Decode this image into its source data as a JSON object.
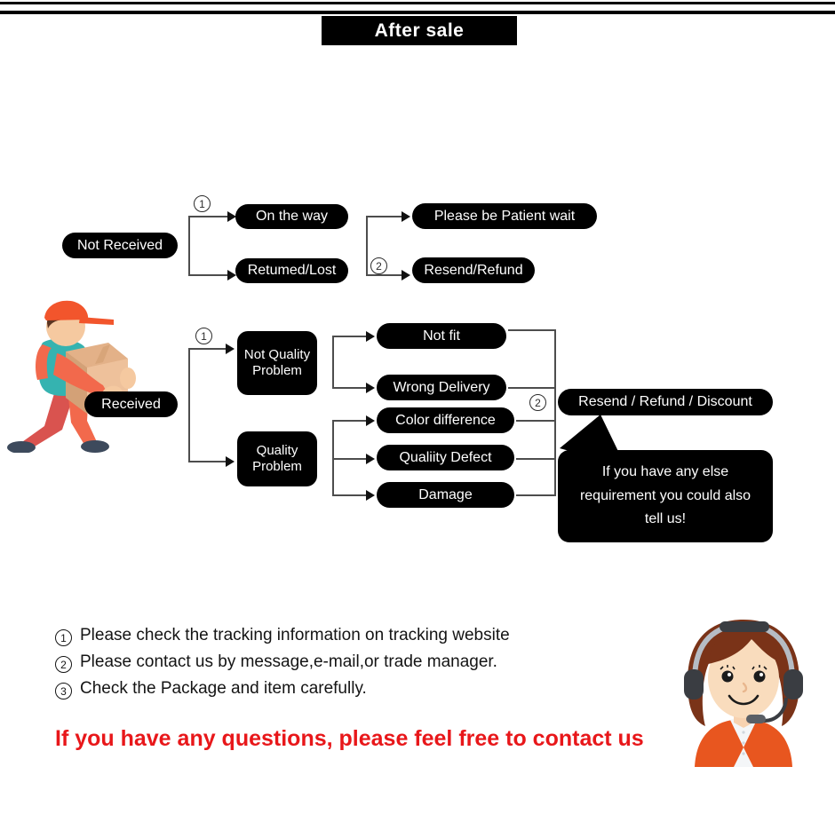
{
  "header": {
    "title": "After sale"
  },
  "flow_not_received": {
    "source": {
      "label": "Not Received"
    },
    "marker_1": "1",
    "marker_2": "2",
    "stage1": [
      {
        "label": "On the way"
      },
      {
        "label": "Retumed/Lost"
      }
    ],
    "stage2": [
      {
        "label": "Please be Patient wait"
      },
      {
        "label": "Resend/Refund"
      }
    ]
  },
  "flow_received": {
    "source": {
      "label": "Received"
    },
    "marker_1": "1",
    "marker_2": "2",
    "categories": [
      {
        "label": "Not Quality Problem"
      },
      {
        "label": "Quality Problem"
      }
    ],
    "issues": [
      {
        "label": "Not fit"
      },
      {
        "label": "Wrong Delivery"
      },
      {
        "label": "Color difference"
      },
      {
        "label": "Qualiity Defect"
      },
      {
        "label": "Damage"
      }
    ],
    "resolution": {
      "label": "Resend / Refund / Discount"
    },
    "bubble": {
      "text": "If you have any else requirement you could also tell us!"
    }
  },
  "notes": [
    {
      "num": "1",
      "text": "Please check the tracking information on tracking website"
    },
    {
      "num": "2",
      "text": "Please contact us by message,e-mail,or trade manager."
    },
    {
      "num": "3",
      "text": "Check the Package and item carefully."
    }
  ],
  "footer": {
    "red_text": "If you have any questions, please feel free to contact us"
  },
  "illustrations": {
    "courier": "delivery-man-carrying-box-illustration",
    "agent": "customer-service-agent-headset-illustration"
  },
  "colors": {
    "node_bg": "#000000",
    "node_text": "#ffffff",
    "connector": "#4d4d4d",
    "accent_red": "#e8171a",
    "courier_shirt": "#3bb9b5",
    "courier_cap": "#f2552c",
    "courier_pants": "#f2552c",
    "box_tan": "#e3b188",
    "agent_hair": "#8c3a22",
    "agent_sweater": "#e8561f"
  }
}
